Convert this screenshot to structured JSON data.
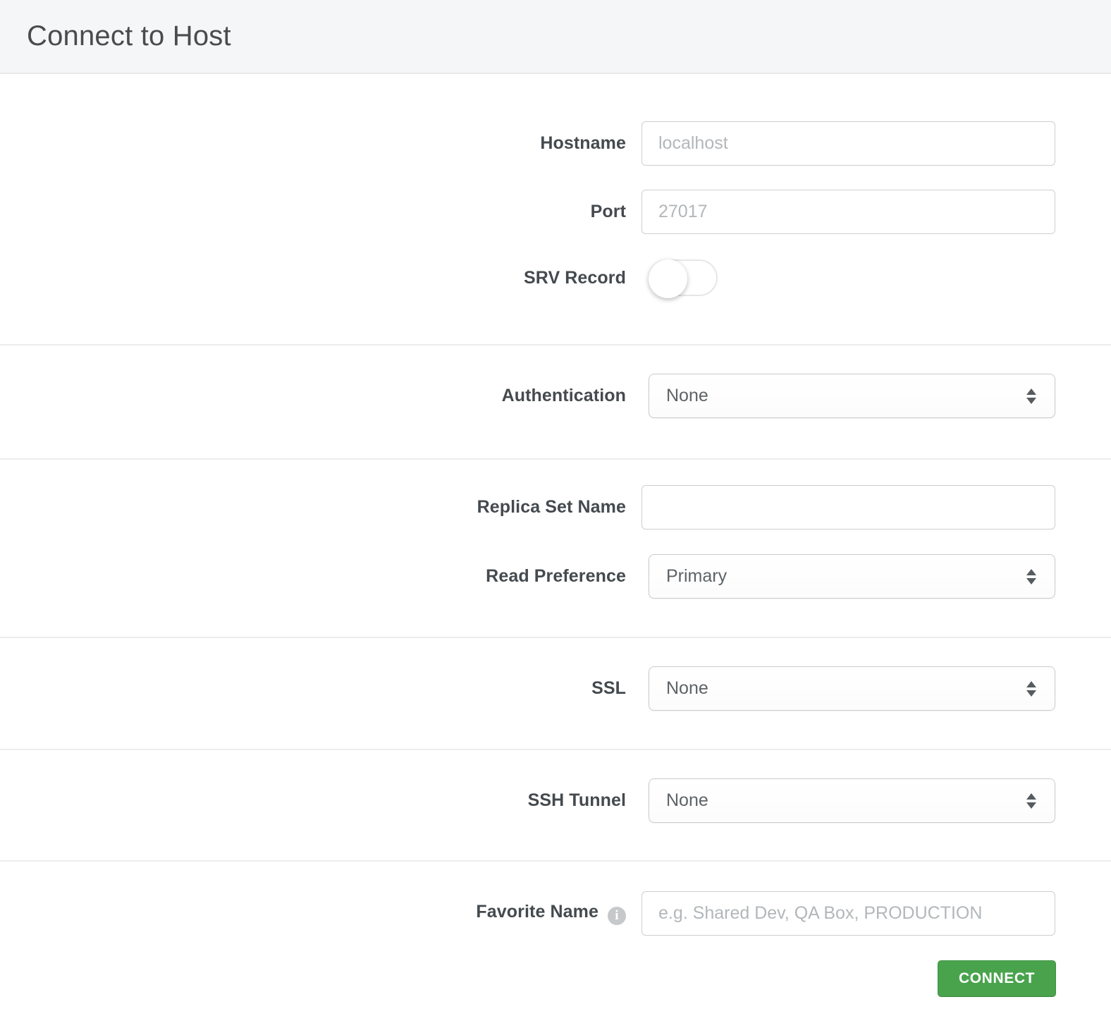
{
  "header": {
    "title": "Connect to Host"
  },
  "form": {
    "hostname": {
      "label": "Hostname",
      "value": "",
      "placeholder": "localhost"
    },
    "port": {
      "label": "Port",
      "value": "",
      "placeholder": "27017"
    },
    "srv_record": {
      "label": "SRV Record",
      "enabled": false
    },
    "authentication": {
      "label": "Authentication",
      "selected": "None"
    },
    "replica_set_name": {
      "label": "Replica Set Name",
      "value": "",
      "placeholder": ""
    },
    "read_preference": {
      "label": "Read Preference",
      "selected": "Primary"
    },
    "ssl": {
      "label": "SSL",
      "selected": "None"
    },
    "ssh_tunnel": {
      "label": "SSH Tunnel",
      "selected": "None"
    },
    "favorite_name": {
      "label": "Favorite Name",
      "value": "",
      "placeholder": "e.g. Shared Dev, QA Box, PRODUCTION"
    }
  },
  "actions": {
    "connect_label": "CONNECT"
  },
  "icons": {
    "info_glyph": "i",
    "select_arrows": "updown-arrows-icon"
  },
  "colors": {
    "accent_green": "#49a34d",
    "header_bg": "#f5f6f7",
    "divider": "#ececee",
    "label_text": "#444a4e",
    "placeholder_text": "#b3b7ba"
  }
}
